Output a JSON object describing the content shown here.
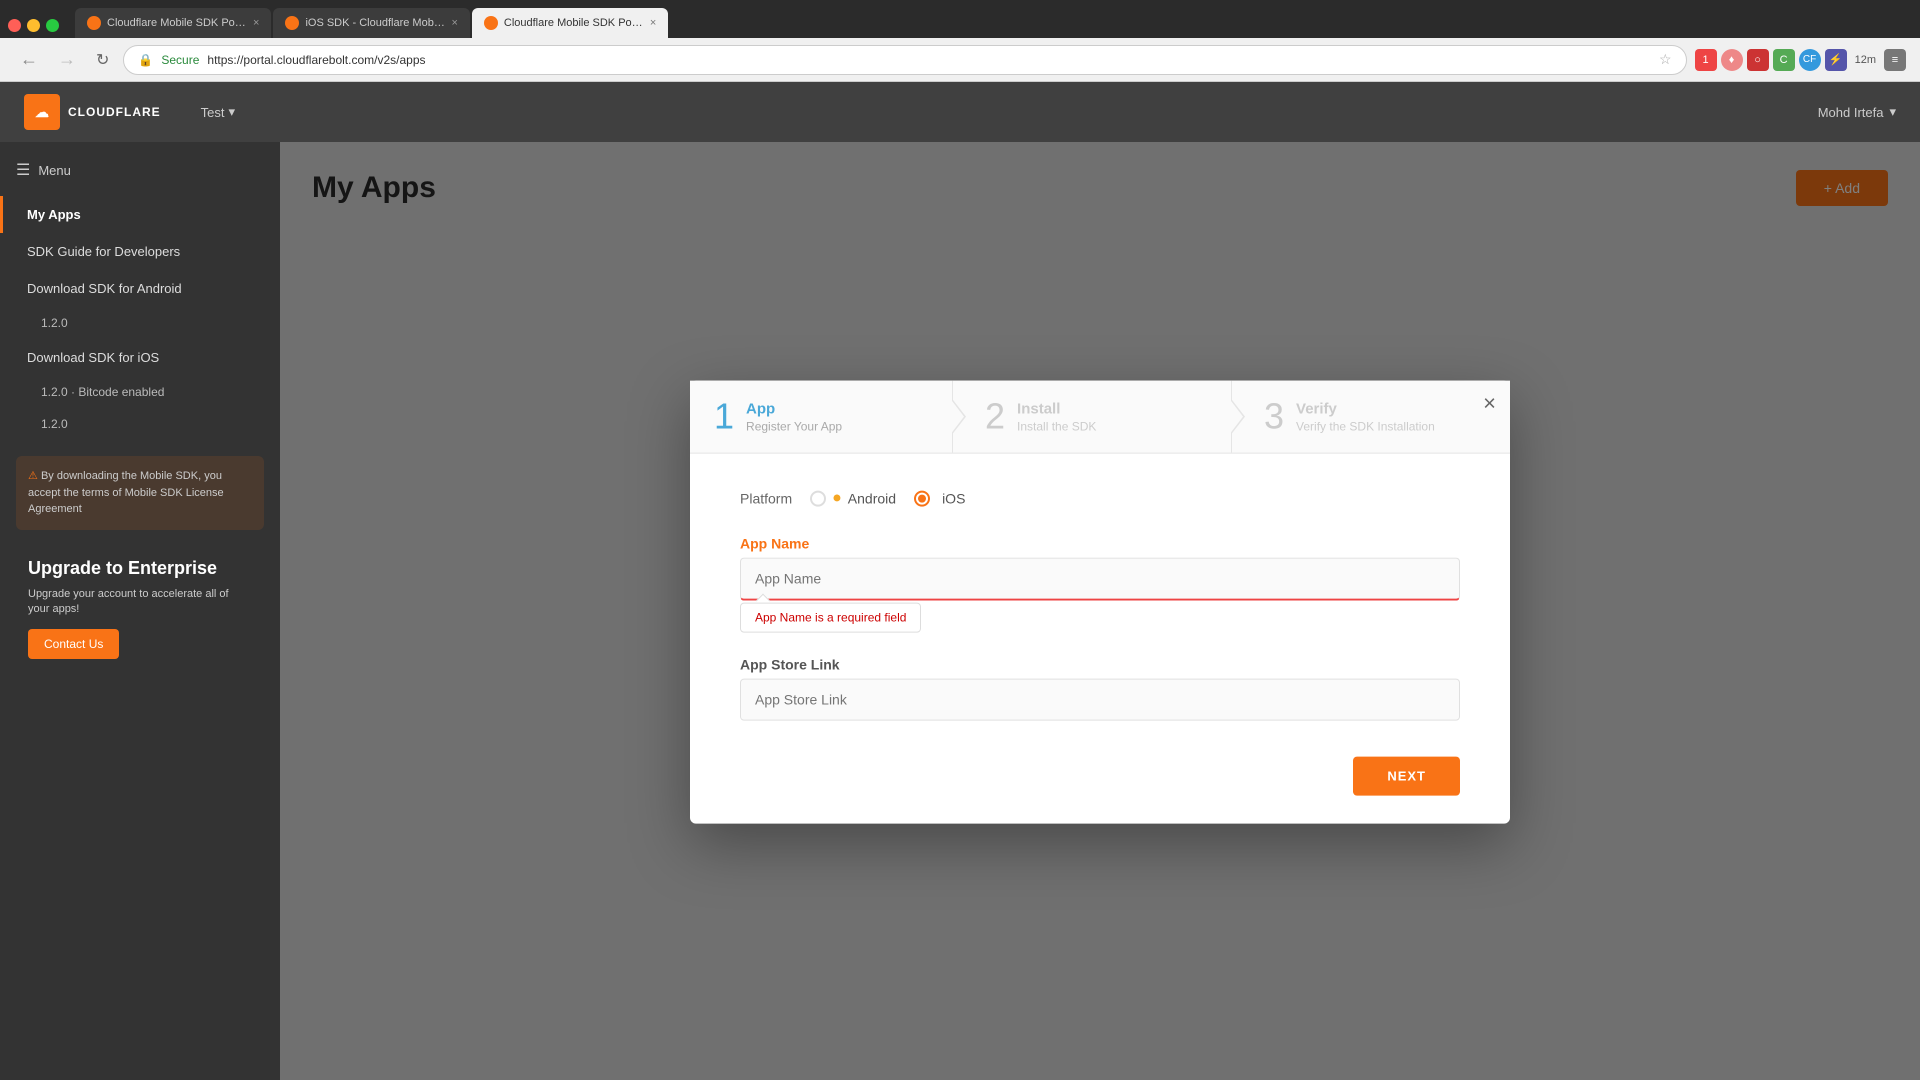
{
  "browser": {
    "tabs": [
      {
        "id": "tab1",
        "label": "Cloudflare Mobile SDK Portal",
        "active": false,
        "favicon_color": "#f97316"
      },
      {
        "id": "tab2",
        "label": "iOS SDK - Cloudflare Mobile S...",
        "active": false,
        "favicon_color": "#f97316"
      },
      {
        "id": "tab3",
        "label": "Cloudflare Mobile SDK Portal",
        "active": true,
        "favicon_color": "#f97316"
      }
    ],
    "address": "https://portal.cloudflarebolt.com/v2s/apps",
    "secure_label": "Secure"
  },
  "nav": {
    "logo_text": "CLOUDFLARE",
    "apple_icon": "",
    "org_name": "Test",
    "user_name": "Mohd Irtefa",
    "user_dropdown": "▾"
  },
  "sidebar": {
    "menu_label": "Menu",
    "items": [
      {
        "label": "My Apps",
        "active": true
      },
      {
        "label": "SDK Guide for Developers",
        "active": false
      },
      {
        "label": "Download SDK for Android",
        "active": false
      },
      {
        "label": "1.2.0",
        "active": false,
        "sub": true
      },
      {
        "label": "Download SDK for iOS",
        "active": false
      },
      {
        "label": "1.2.0 · Bitcode enabled",
        "active": false,
        "sub": true
      },
      {
        "label": "1.2.0",
        "active": false,
        "sub": true
      }
    ],
    "notice_text": "By downloading the Mobile SDK, you accept the terms of Mobile SDK License Agreement",
    "upgrade_title": "Upgrade to Enterprise",
    "upgrade_desc": "Upgrade your account to accelerate all of your apps!",
    "upgrade_btn": "Contact Us"
  },
  "page": {
    "title": "My Apps",
    "add_btn": "+ Add"
  },
  "modal": {
    "close_icon": "×",
    "steps": [
      {
        "number": "1",
        "title": "App",
        "subtitle": "Register Your App",
        "active": true
      },
      {
        "number": "2",
        "title": "Install",
        "subtitle": "Install the SDK",
        "active": false
      },
      {
        "number": "3",
        "title": "Verify",
        "subtitle": "Verify the SDK Installation",
        "active": false
      }
    ],
    "platform_label": "Platform",
    "android_label": "Android",
    "ios_label": "iOS",
    "selected_platform": "iOS",
    "app_name_label": "App Name",
    "app_name_placeholder": "App Name",
    "app_name_error": "App Name is a required field",
    "app_store_label": "App Store Link",
    "app_store_placeholder": "App Store Link",
    "next_btn": "NEXT"
  }
}
